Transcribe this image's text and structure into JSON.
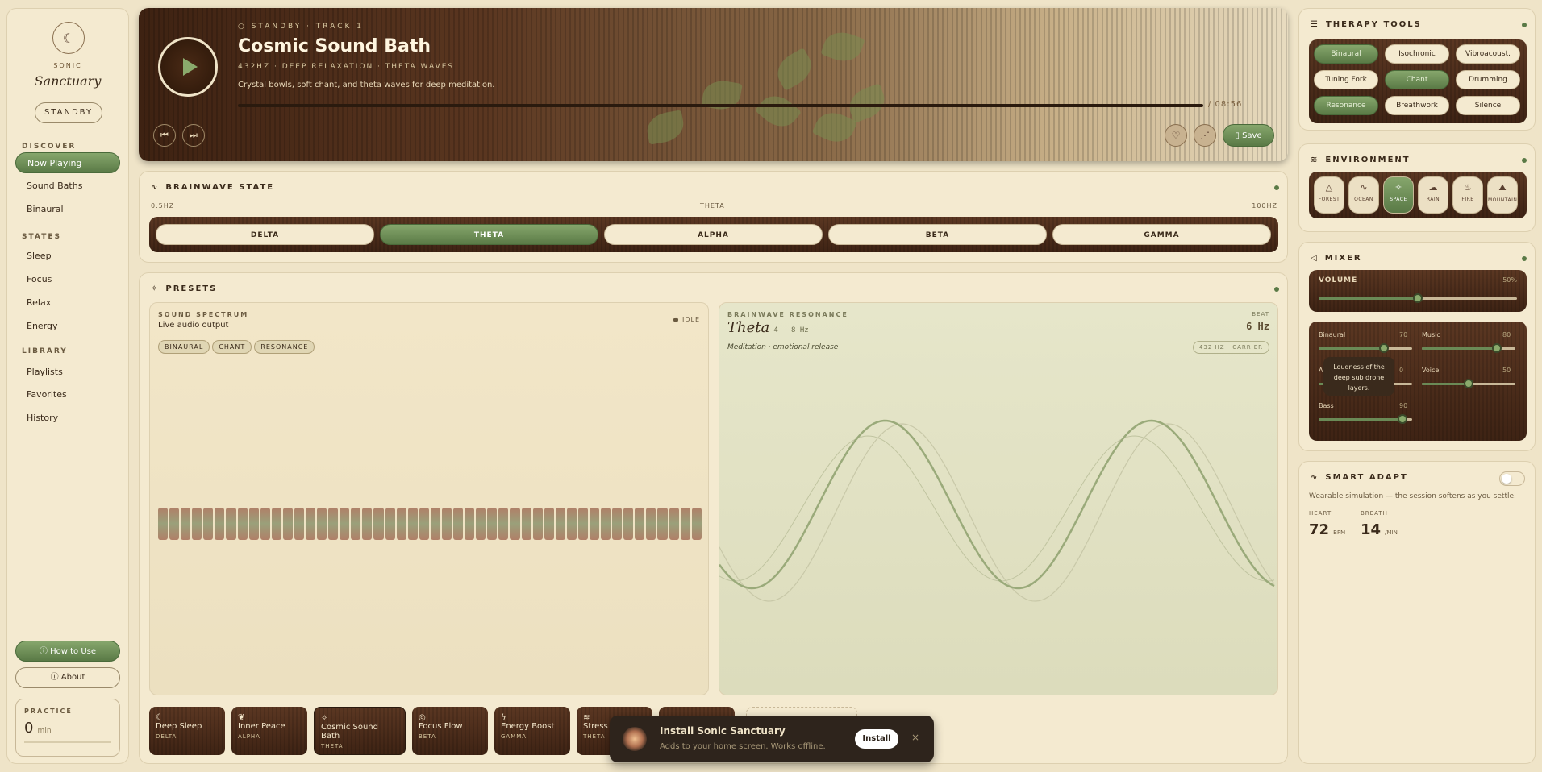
{
  "sidebar": {
    "brand_top": "SONIC",
    "brand": "Sanctuary",
    "status": "STANDBY",
    "sections": {
      "discover": "DISCOVER",
      "states": "STATES",
      "library": "LIBRARY"
    },
    "discover": [
      "Now Playing",
      "Sound Baths",
      "Binaural"
    ],
    "states": [
      "Sleep",
      "Focus",
      "Relax",
      "Energy"
    ],
    "library": [
      "Playlists",
      "Favorites",
      "History"
    ],
    "how_to": "How to Use",
    "about": "About",
    "practice_label": "PRACTICE",
    "practice_value": "0",
    "practice_unit": "min"
  },
  "player": {
    "kicker": "○ STANDBY · TRACK 1",
    "title": "Cosmic Sound Bath",
    "subtitle": "432HZ · DEEP RELAXATION · THETA WAVES",
    "description": "Crystal bowls, soft chant, and theta waves for deep meditation.",
    "time": "/ 08:56",
    "save": "Save"
  },
  "brainwave": {
    "title": "BRAINWAVE STATE",
    "min": "0.5HZ",
    "current": "THETA",
    "max": "100HZ",
    "states": [
      "DELTA",
      "THETA",
      "ALPHA",
      "BETA",
      "GAMMA"
    ],
    "active_index": 1
  },
  "presets": {
    "title": "PRESETS",
    "spectrum": {
      "title": "SOUND SPECTRUM",
      "subtitle": "Live audio output",
      "status": "IDLE",
      "tags": [
        "BINAURAL",
        "CHANT",
        "RESONANCE"
      ]
    },
    "resonance": {
      "title": "BRAINWAVE RESONANCE",
      "beat_label": "BEAT",
      "state": "Theta",
      "range": "4 – 8 Hz",
      "beat": "6 Hz",
      "description": "Meditation · emotional release",
      "carrier": "432 HZ · CARRIER"
    },
    "chips": [
      {
        "name": "Deep Sleep",
        "wave": "DELTA",
        "icon": "moon-icon"
      },
      {
        "name": "Inner Peace",
        "wave": "ALPHA",
        "icon": "leaf-icon"
      },
      {
        "name": "Cosmic Sound Bath",
        "wave": "THETA",
        "icon": "sparkle-icon"
      },
      {
        "name": "Focus Flow",
        "wave": "BETA",
        "icon": "target-icon"
      },
      {
        "name": "Energy Boost",
        "wave": "GAMMA",
        "icon": "bolt-icon"
      },
      {
        "name": "Stress",
        "wave": "THETA",
        "icon": "wind-icon"
      }
    ]
  },
  "install": {
    "title": "Install Sonic Sanctuary",
    "subtitle": "Adds to your home screen. Works offline.",
    "button": "Install"
  },
  "tools": {
    "title": "THERAPY TOOLS",
    "items": [
      "Binaural",
      "Isochronic",
      "Vibroacoust.",
      "Tuning Fork",
      "Chant",
      "Drumming",
      "Resonance",
      "Breathwork",
      "Silence"
    ],
    "active": [
      0,
      4,
      6
    ]
  },
  "environment": {
    "title": "ENVIRONMENT",
    "items": [
      {
        "label": "FOREST",
        "icon": "tree-icon"
      },
      {
        "label": "OCEAN",
        "icon": "wave-icon"
      },
      {
        "label": "SPACE",
        "icon": "sparkle-icon"
      },
      {
        "label": "RAIN",
        "icon": "cloud-icon"
      },
      {
        "label": "FIRE",
        "icon": "flame-icon"
      },
      {
        "label": "MOUNTAIN",
        "icon": "mountain-icon"
      }
    ],
    "active_index": 2
  },
  "mixer": {
    "title": "MIXER",
    "volume_label": "VOLUME",
    "volume_value": "50%",
    "volume": 0.5,
    "channels": [
      {
        "label": "Binaural",
        "value": "70",
        "level": 0.7
      },
      {
        "label": "Music",
        "value": "80",
        "level": 0.8
      },
      {
        "label": "A",
        "value": "0",
        "level": 0.5
      },
      {
        "label": "Voice",
        "value": "50",
        "level": 0.5
      },
      {
        "label": "Bass",
        "value": "90",
        "level": 0.9
      }
    ],
    "tooltip": "Loudness of the deep sub drone layers."
  },
  "smart": {
    "title": "SMART ADAPT",
    "description": "Wearable simulation — the session softens as you settle.",
    "heart_label": "HEART",
    "heart_value": "72",
    "heart_unit": "BPM",
    "breath_label": "BREATH",
    "breath_value": "14",
    "breath_unit": "/MIN"
  },
  "colors": {
    "accent": "#6a8a56",
    "wood": "#4a2c1a",
    "paper": "#f4ead0"
  }
}
